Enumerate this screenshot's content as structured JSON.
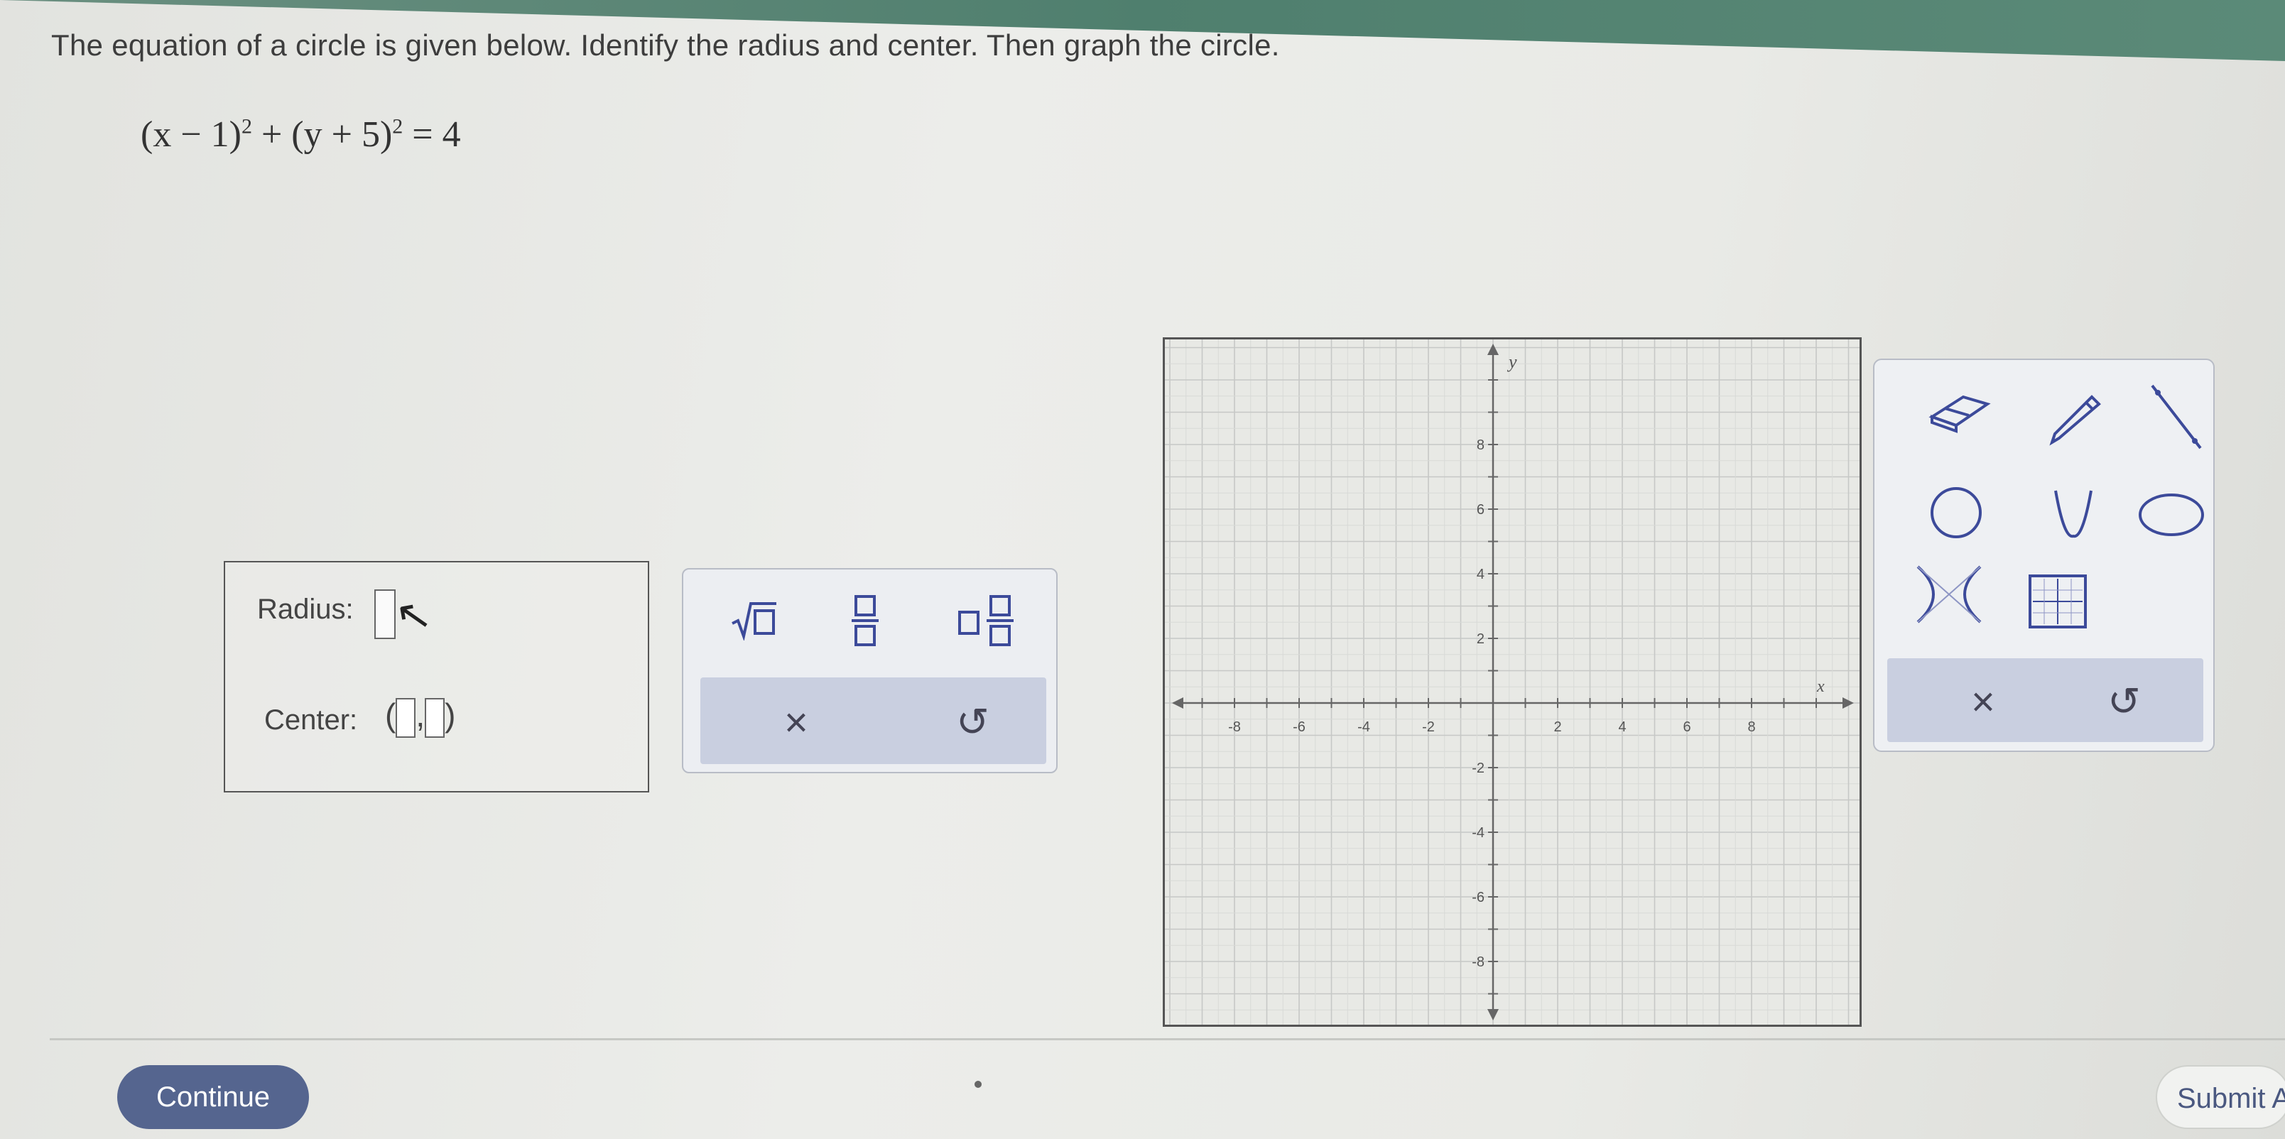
{
  "question": {
    "prompt": "The equation of a circle is given below. Identify the radius and center. Then graph the circle.",
    "equation_left": "(x − 1)",
    "exp1": "2",
    "equation_mid": " + (y + 5)",
    "exp2": "2",
    "equation_right": " = 4"
  },
  "answer": {
    "radius_label": "Radius:",
    "center_label": "Center:",
    "center_open": "(",
    "center_sep": ",",
    "center_close": ")"
  },
  "math_pad": {
    "sqrt": "√□",
    "fraction": "□/□",
    "mixed": "□□/□",
    "clear": "×",
    "undo": "↺"
  },
  "graph": {
    "x_axis_label": "x",
    "y_axis_label": "y",
    "x_ticks": [
      "-8",
      "-6",
      "-4",
      "-2",
      "2",
      "4",
      "6",
      "8"
    ],
    "y_ticks": [
      "8",
      "6",
      "4",
      "2",
      "-2",
      "-4",
      "-6",
      "-8"
    ]
  },
  "tools": {
    "clear": "×",
    "undo": "↺",
    "icons": [
      "eraser-icon",
      "pencil-icon",
      "line-icon",
      "circle-icon",
      "parabola-icon",
      "ellipse-icon",
      "hyperbola-icon",
      "graph-table-icon"
    ]
  },
  "footer": {
    "continue_label": "Continue",
    "submit_label": "Submit A"
  }
}
